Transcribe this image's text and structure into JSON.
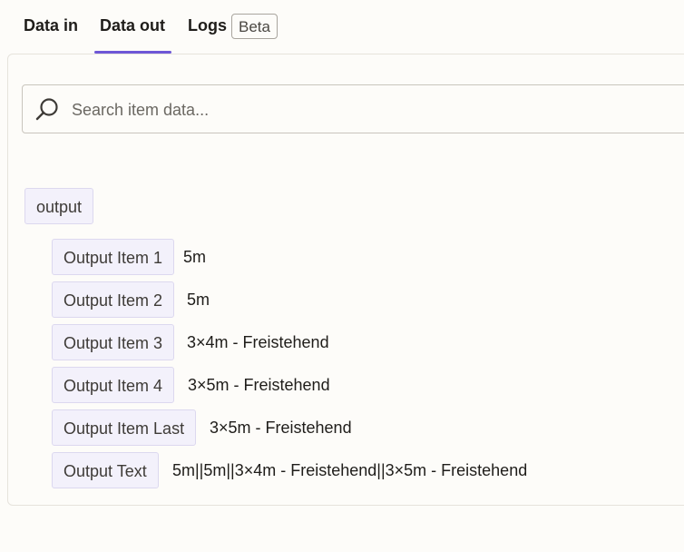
{
  "tabs": {
    "data_in": "Data in",
    "data_out": "Data out",
    "logs": "Logs",
    "beta": "Beta"
  },
  "search": {
    "placeholder": "Search item data..."
  },
  "output": {
    "key": "output",
    "items": [
      {
        "key": "Output Item 1",
        "value": "5m"
      },
      {
        "key": "Output Item 2",
        "value": "5m"
      },
      {
        "key": "Output Item 3",
        "value": "3×4m - Freistehend"
      },
      {
        "key": "Output Item 4",
        "value": "3×5m - Freistehend"
      },
      {
        "key": "Output Item Last",
        "value": "3×5m - Freistehend"
      },
      {
        "key": "Output Text",
        "value": "5m||5m||3×4m - Freistehend||3×5m - Freistehend"
      }
    ]
  },
  "colors": {
    "accent": "#6e57d6",
    "key_background": "#f3f1fb"
  }
}
